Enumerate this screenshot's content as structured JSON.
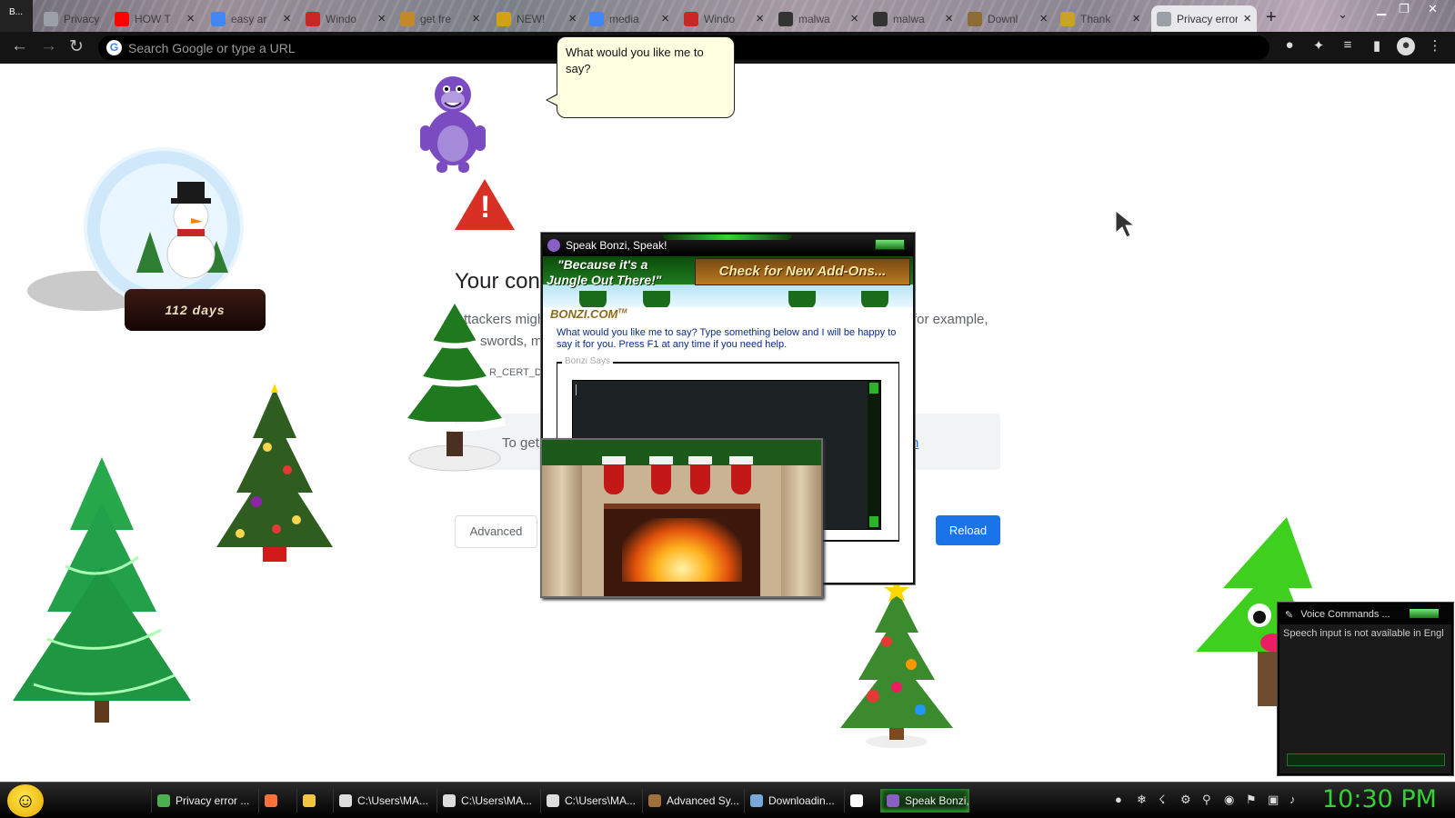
{
  "browser": {
    "app_button_label": "B...",
    "tabs": [
      {
        "label": "Privacy",
        "icon": "privacy-icon",
        "color": "#9aa0a6",
        "active": false
      },
      {
        "label": "HOW T",
        "icon": "youtube-icon",
        "color": "#ff0000",
        "active": false
      },
      {
        "label": "easy ar",
        "icon": "google-icon",
        "color": "#4285f4",
        "active": false
      },
      {
        "label": "Windo",
        "icon": "windows-icon",
        "color": "#c62828",
        "active": false
      },
      {
        "label": "get fre",
        "icon": "page-icon",
        "color": "#c08a2b",
        "active": false
      },
      {
        "label": "NEW!",
        "icon": "page-icon",
        "color": "#d4a017",
        "active": false
      },
      {
        "label": "media",
        "icon": "google-icon",
        "color": "#4285f4",
        "active": false
      },
      {
        "label": "Windo",
        "icon": "windows-icon",
        "color": "#c62828",
        "active": false
      },
      {
        "label": "malwa",
        "icon": "library-icon",
        "color": "#333333",
        "active": false
      },
      {
        "label": "malwa",
        "icon": "library-icon",
        "color": "#333333",
        "active": false
      },
      {
        "label": "Downl",
        "icon": "page-icon",
        "color": "#8e6b36",
        "active": false
      },
      {
        "label": "Thank",
        "icon": "page-icon",
        "color": "#c9a227",
        "active": false
      },
      {
        "label": "Privacy error",
        "icon": "privacy-icon",
        "color": "#9aa0a6",
        "active": true
      }
    ],
    "omnibox_placeholder": "Search Google or type a URL"
  },
  "error_page": {
    "title": "Your con",
    "line1_left": "ttackers migh",
    "line1_right": "for example,",
    "line2": "swords, me",
    "code": "R_CERT_DA",
    "tip": "To get",
    "tip_link": "n",
    "advanced_label": "Advanced",
    "reload_label": "Reload",
    "warning_color": "#d93025",
    "accent_color": "#1a73e8"
  },
  "snow_globe": {
    "counter": "112 days"
  },
  "bubble": {
    "text": "What would you like me to say?"
  },
  "bonzi_dialog": {
    "title": "Speak Bonzi, Speak!",
    "slogan_line1": "\"Because it's a",
    "slogan_line2": "Jungle Out There!\"",
    "addons_label": "Check for New Add-Ons...",
    "logo": "BONZI.COM",
    "logo_tm": "TM",
    "instructions": "What would you like me to say? Type something below and I will be happy to say it for you. Press F1 at any time if you need help.",
    "group_label": "Bonzi Says",
    "text_value": ""
  },
  "voice_commands": {
    "title": "Voice Commands ...",
    "message": "Speech input is not available in Engl",
    "level": 0
  },
  "taskbar": {
    "items": [
      {
        "label": "Privacy error ...",
        "icon": "chrome-icon",
        "color": "#4caf50"
      },
      {
        "label": "",
        "icon": "firefox-icon",
        "color": "#ff7139"
      },
      {
        "label": "",
        "icon": "folder-icon",
        "color": "#f4c542"
      },
      {
        "label": "C:\\Users\\MA...",
        "icon": "archive-icon",
        "color": "#dddddd"
      },
      {
        "label": "C:\\Users\\MA...",
        "icon": "archive-icon",
        "color": "#dddddd"
      },
      {
        "label": "C:\\Users\\MA...",
        "icon": "archive-icon",
        "color": "#dddddd"
      },
      {
        "label": "Advanced Sy...",
        "icon": "system-icon",
        "color": "#a0703c"
      },
      {
        "label": "Downloadin...",
        "icon": "download-icon",
        "color": "#7aa7d9"
      },
      {
        "label": "",
        "icon": "yandex-icon",
        "color": "#ffffff"
      },
      {
        "label": "Speak Bonzi,...",
        "icon": "bonzi-icon",
        "color": "#8a5fc4"
      }
    ],
    "clock": "10:30 PM",
    "clock_color": "#33d133"
  }
}
